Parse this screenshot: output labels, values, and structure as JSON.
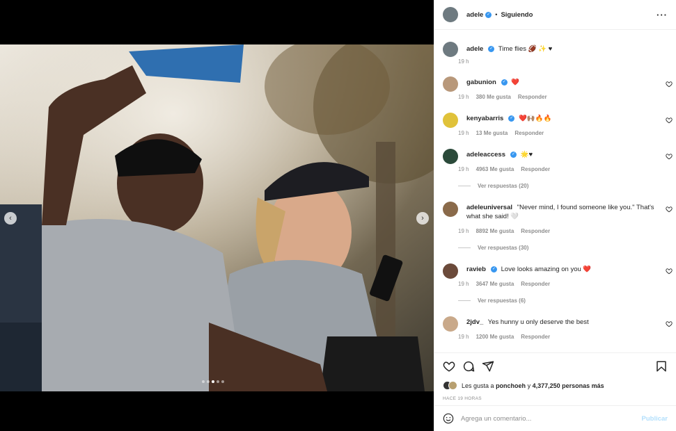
{
  "post": {
    "author": "adele",
    "follow_status": "Siguiendo",
    "caption": "Time flies 🏈 ✨ ♥",
    "caption_time": "19 h"
  },
  "comments": [
    {
      "user": "gabunion",
      "verified": true,
      "text": "❤️",
      "time": "19 h",
      "likes": "380 Me gusta",
      "reply": "Responder",
      "avatar_color": "#b8987a"
    },
    {
      "user": "kenyabarris",
      "verified": true,
      "text": "❤️🙌🏽🔥🔥",
      "time": "19 h",
      "likes": "13 Me gusta",
      "reply": "Responder",
      "avatar_color": "#e0c23a"
    },
    {
      "user": "adeleaccess",
      "verified": true,
      "text": "🌟♥",
      "time": "19 h",
      "likes": "4963 Me gusta",
      "reply": "Responder",
      "view_replies": "Ver respuestas (20)",
      "avatar_color": "#2b4a3a"
    },
    {
      "user": "adeleuniversal",
      "verified": false,
      "text": "\"Never mind, I found someone like you.\" That's what she said! 🤍",
      "time": "19 h",
      "likes": "8892 Me gusta",
      "reply": "Responder",
      "view_replies": "Ver respuestas (30)",
      "avatar_color": "#8a6a4a"
    },
    {
      "user": "ravieb",
      "verified": true,
      "text": "Love looks amazing on you ❤️",
      "time": "19 h",
      "likes": "3647 Me gusta",
      "reply": "Responder",
      "view_replies": "Ver respuestas (6)",
      "avatar_color": "#6b4a3a"
    },
    {
      "user": "2jdv_",
      "verified": false,
      "text": "Yes hunny u only deserve the best",
      "time": "19 h",
      "likes": "1200 Me gusta",
      "reply": "Responder",
      "avatar_color": "#c9a98a"
    }
  ],
  "likes_line": {
    "prefix": "Les gusta a",
    "user": "ponchoeh",
    "middle": "y",
    "count": "4,377,250 personas más"
  },
  "posted_ago": "HACE 19 HORAS",
  "comment_input": {
    "placeholder": "Agrega un comentario...",
    "submit": "Publicar"
  },
  "colors": {
    "verified": "#3897f0",
    "heart": "#ed4956",
    "publish_disabled": "#b2dffc"
  },
  "icons": [
    "chevron-left-icon",
    "chevron-right-icon",
    "more-options-icon",
    "heart-icon",
    "comment-icon",
    "share-icon",
    "save-icon",
    "emoji-icon"
  ]
}
